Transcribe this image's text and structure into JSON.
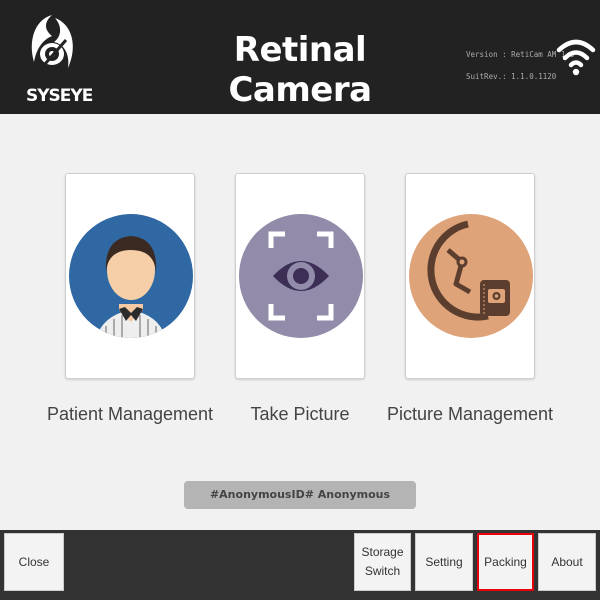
{
  "header": {
    "logo_text": "SYSEYE",
    "title": "Retinal Camera",
    "version_line": "Version : RetiCam AM 1.0",
    "suit_rev_line": "SuitRev.: 1.1.0.1120"
  },
  "main": {
    "cards": [
      {
        "label": "Patient Management",
        "icon": "patient-avatar-icon",
        "color": "#2f68a3"
      },
      {
        "label": "Take Picture",
        "icon": "eye-scan-icon",
        "color": "#928ba9"
      },
      {
        "label": "Picture Management",
        "icon": "gallery-icon",
        "color": "#dfa37a"
      }
    ],
    "patient_bar": "#AnonymousID#   Anonymous"
  },
  "footer": {
    "buttons": [
      {
        "label": "Close"
      },
      {
        "label": "Storage Switch"
      },
      {
        "label": "Setting"
      },
      {
        "label": "Packing",
        "selected": true
      },
      {
        "label": "About"
      }
    ]
  },
  "colors": {
    "header_bg": "#222222",
    "footer_bg": "#333333",
    "selected_outline": "#e8000a"
  }
}
